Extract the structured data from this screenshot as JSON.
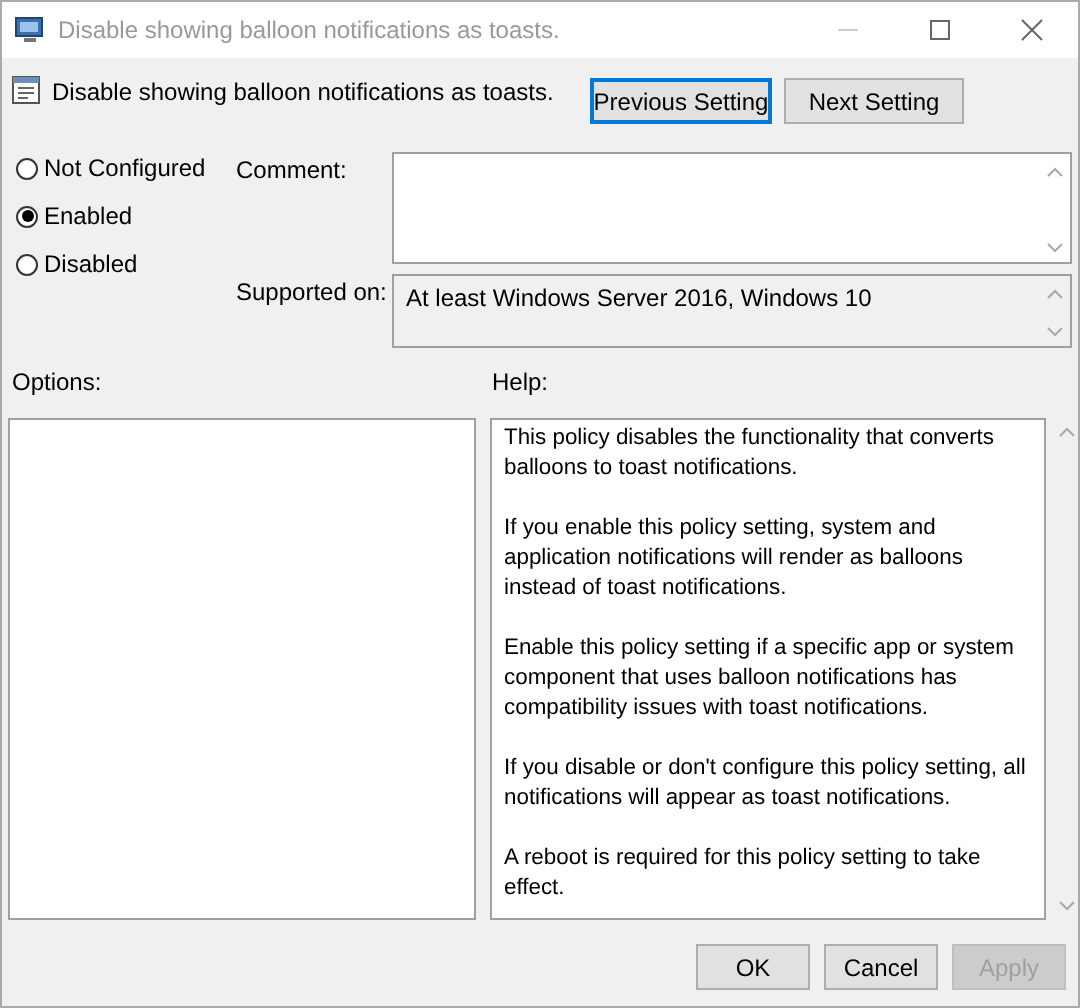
{
  "window": {
    "title": "Disable showing balloon notifications as toasts."
  },
  "header": {
    "title": "Disable showing balloon notifications as toasts.",
    "buttons": [
      {
        "label": "Previous Setting",
        "focused": true
      },
      {
        "label": "Next Setting",
        "focused": false
      }
    ]
  },
  "state_options": [
    {
      "label": "Not Configured",
      "selected": false
    },
    {
      "label": "Enabled",
      "selected": true
    },
    {
      "label": "Disabled",
      "selected": false
    }
  ],
  "comment": {
    "label": "Comment:"
  },
  "supported_on": {
    "label": "Supported on:",
    "value": "At least Windows Server 2016, Windows 10"
  },
  "options": {
    "label": "Options:"
  },
  "help": {
    "label": "Help:",
    "paragraphs": [
      "This policy disables the functionality that converts balloons to toast notifications.",
      "If you enable this policy setting, system and application notifications will render as balloons instead of toast notifications.",
      "Enable this policy setting if a specific app or system component that uses balloon notifications has compatibility issues with toast notifications.",
      "If you disable or don't configure this policy setting, all notifications will appear as toast notifications.",
      "A reboot is required for this policy setting to take effect."
    ]
  },
  "buttons": [
    {
      "label": "OK",
      "disabled": false
    },
    {
      "label": "Cancel",
      "disabled": false
    },
    {
      "label": "Apply",
      "disabled": true
    }
  ]
}
